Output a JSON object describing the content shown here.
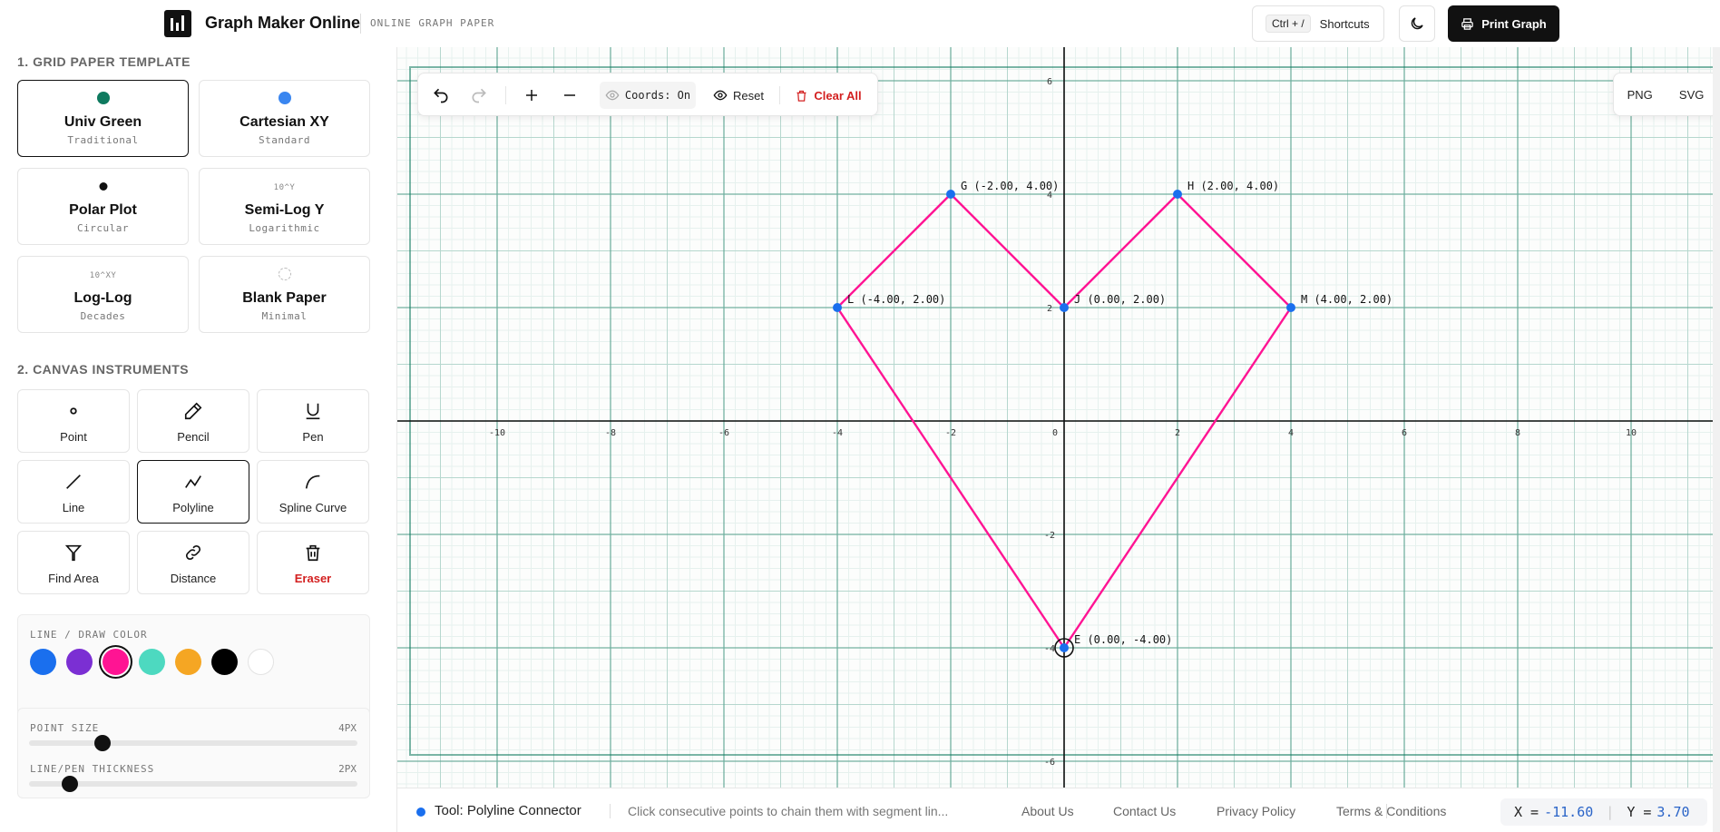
{
  "header": {
    "brand": "Graph Maker Online",
    "subtitle": "ONLINE GRAPH PAPER",
    "shortcuts_key": "Ctrl + /",
    "shortcuts_label": "Shortcuts",
    "print_label": "Print Graph"
  },
  "sidebar": {
    "templates_title": "1. GRID PAPER TEMPLATE",
    "templates": [
      {
        "name": "Univ Green",
        "sub": "Traditional",
        "icon": "green-dot-icon",
        "color": "#0f7a5f",
        "active": true
      },
      {
        "name": "Cartesian XY",
        "sub": "Standard",
        "icon": "blue-dot-icon",
        "color": "#3a86f0",
        "active": false
      },
      {
        "name": "Polar Plot",
        "sub": "Circular",
        "icon": "black-dot-icon",
        "color": "#111111",
        "active": false
      },
      {
        "name": "Semi-Log Y",
        "sub": "Logarithmic",
        "icon_text": "10^Y",
        "active": false
      },
      {
        "name": "Log-Log",
        "sub": "Decades",
        "icon_text": "10^XY",
        "active": false
      },
      {
        "name": "Blank Paper",
        "sub": "Minimal",
        "icon": "dashed-circle-icon",
        "active": false
      }
    ],
    "instruments_title": "2. CANVAS INSTRUMENTS",
    "tools": [
      {
        "label": "Point",
        "icon": "point-icon"
      },
      {
        "label": "Pencil",
        "icon": "pencil-icon"
      },
      {
        "label": "Pen",
        "icon": "pen-icon"
      },
      {
        "label": "Line",
        "icon": "line-icon"
      },
      {
        "label": "Polyline",
        "icon": "polyline-icon",
        "active": true
      },
      {
        "label": "Spline Curve",
        "icon": "spline-icon"
      },
      {
        "label": "Find Area",
        "icon": "area-icon"
      },
      {
        "label": "Distance",
        "icon": "link-icon"
      },
      {
        "label": "Eraser",
        "icon": "trash-icon",
        "danger": true
      }
    ],
    "color_label": "LINE / DRAW COLOR",
    "colors": [
      "#1a6fee",
      "#7b2fd3",
      "#ff1493",
      "#4dd9c0",
      "#f5a623",
      "#000000",
      "#ffffff"
    ],
    "selected_color": "#ff1493",
    "point_size_label": "POINT SIZE",
    "point_size_value": "4PX",
    "point_size_fraction": 0.2,
    "thickness_label": "LINE/PEN THICKNESS",
    "thickness_value": "2PX",
    "thickness_fraction": 0.1
  },
  "toolbar": {
    "coords_label": "Coords: On",
    "reset_label": "Reset",
    "clear_label": "Clear All"
  },
  "export": {
    "png": "PNG",
    "svg": "SVG"
  },
  "status": {
    "tool": "Tool: Polyline Connector",
    "hint": "Click consecutive points to chain them with segment lin...",
    "links": [
      "About Us",
      "Contact Us",
      "Privacy Policy",
      "Terms & Conditions"
    ],
    "x_label": "X =",
    "x_value": "-11.60",
    "y_label": "Y =",
    "y_value": "3.70"
  },
  "graph": {
    "x_ticks": [
      -10,
      -8,
      -6,
      -4,
      -2,
      0,
      2,
      4,
      6,
      8,
      10
    ],
    "y_ticks": [
      6,
      4,
      2,
      -2,
      -4,
      -6
    ],
    "line_color": "#ff1493",
    "point_color": "#1a6fee",
    "grid_color": "#0f7a5f",
    "points": [
      {
        "name": "G",
        "x": -2,
        "y": 4,
        "label": "G (-2.00, 4.00)"
      },
      {
        "name": "H",
        "x": 2,
        "y": 4,
        "label": "H (2.00, 4.00)"
      },
      {
        "name": "L",
        "x": -4,
        "y": 2,
        "label": "L (-4.00, 2.00)"
      },
      {
        "name": "J",
        "x": 0,
        "y": 2,
        "label": "J (0.00, 2.00)"
      },
      {
        "name": "M",
        "x": 4,
        "y": 2,
        "label": "M (4.00, 2.00)"
      },
      {
        "name": "E",
        "x": 0,
        "y": -4,
        "label": "E (0.00, -4.00)",
        "highlight": true
      }
    ],
    "polyline": [
      [
        0,
        -4
      ],
      [
        -4,
        2
      ],
      [
        -2,
        4
      ],
      [
        0,
        2
      ],
      [
        2,
        4
      ],
      [
        4,
        2
      ],
      [
        0,
        -4
      ]
    ]
  }
}
